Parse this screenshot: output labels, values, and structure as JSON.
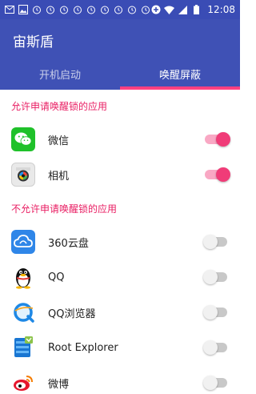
{
  "status_bar": {
    "time": "12:08"
  },
  "app": {
    "title": "宙斯盾"
  },
  "tabs": [
    {
      "label": "开机启动",
      "active": false
    },
    {
      "label": "唤醒屏蔽",
      "active": true
    }
  ],
  "sections": {
    "allowed": {
      "title": "允许申请唤醒锁的应用",
      "apps": [
        {
          "name": "微信",
          "icon": "wechat-icon",
          "enabled": true
        },
        {
          "name": "相机",
          "icon": "camera-icon",
          "enabled": true
        }
      ]
    },
    "blocked": {
      "title": "不允许申请唤醒锁的应用",
      "apps": [
        {
          "name": "360云盘",
          "icon": "360-cloud-icon",
          "enabled": false
        },
        {
          "name": "QQ",
          "icon": "qq-penguin-icon",
          "enabled": false
        },
        {
          "name": "QQ浏览器",
          "icon": "qq-browser-icon",
          "enabled": false
        },
        {
          "name": "Root Explorer",
          "icon": "root-explorer-icon",
          "enabled": false
        },
        {
          "name": "微博",
          "icon": "weibo-icon",
          "enabled": false
        }
      ]
    }
  },
  "colors": {
    "primary": "#3f51b5",
    "status_bar": "#3a4cb5",
    "accent": "#ff4081",
    "section_header": "#e91e63"
  }
}
